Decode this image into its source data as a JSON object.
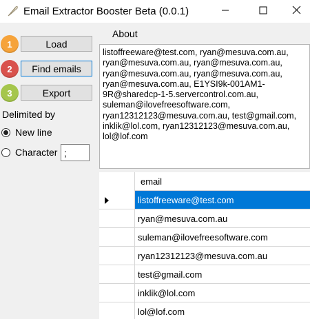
{
  "window": {
    "title": "Email Extractor Booster Beta (0.0.1)",
    "controls": [
      "minimize-icon",
      "maximize-icon",
      "close-icon"
    ]
  },
  "steps": {
    "one": "1",
    "two": "2",
    "three": "3"
  },
  "buttons": {
    "load": "Load",
    "find": "Find emails",
    "export": "Export"
  },
  "delimited": {
    "label": "Delimited by",
    "new_line": "New line",
    "character": "Character",
    "character_value": ";",
    "selected": "new_line"
  },
  "about": {
    "label": "About",
    "text": "listoffreeware@test.com, ryan@mesuva.com.au,\nryan@mesuva.com.au, ryan@mesuva.com.au,\nryan@mesuva.com.au, ryan@mesuva.com.au,\nryan@mesuva.com.au, E1YSI9k-001AM1-\n9R@sharedcp-1-5.servercontrol.com.au,\nsuleman@ilovefreesoftware.com,\nryan12312123@mesuva.com.au, test@gmail.com,\ninklik@lol.com, ryan12312123@mesuva.com.au,\nlol@lof.com"
  },
  "grid": {
    "column": "email",
    "rows": [
      "listoffreeware@test.com",
      "ryan@mesuva.com.au",
      "suleman@ilovefreesoftware.com",
      "ryan12312123@mesuva.com.au",
      "test@gmail.com",
      "inklik@lol.com",
      "lol@lof.com"
    ],
    "selected_row": 0
  },
  "colors": {
    "selection": "#0078d7",
    "step1": "#f6a33a",
    "step2": "#d9524c",
    "step3": "#a5c64c"
  }
}
